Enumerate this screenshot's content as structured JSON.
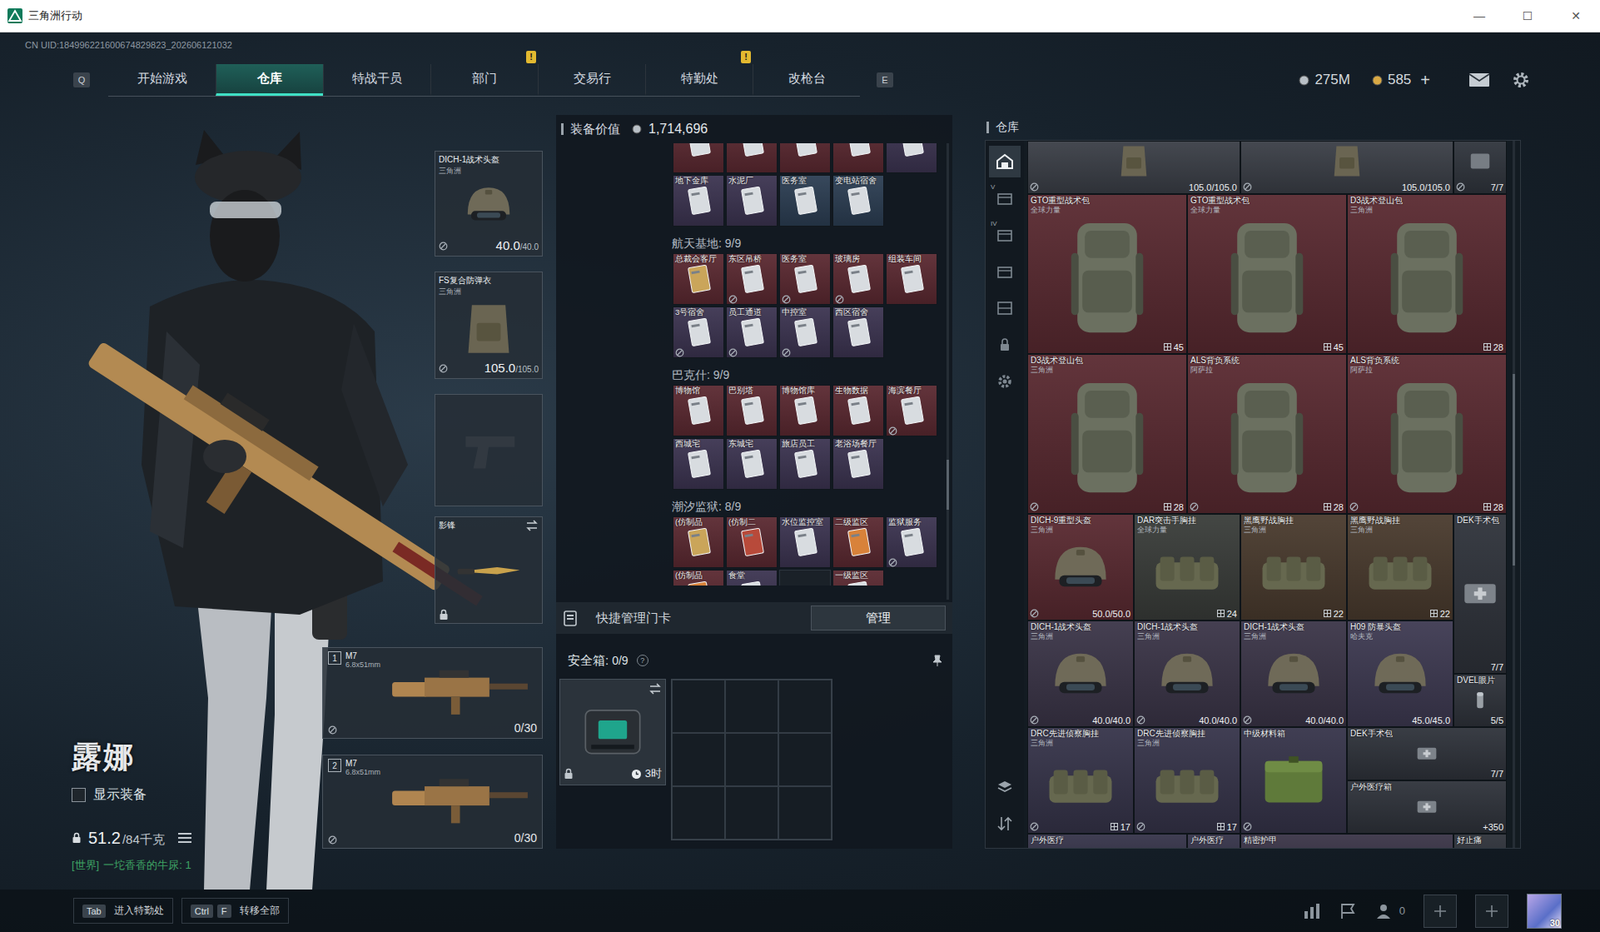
{
  "window": {
    "title": "三角洲行动",
    "controls": [
      "—",
      "☐",
      "✕"
    ]
  },
  "uid": "CN UID:184996221600674829823_202606121032",
  "nav": {
    "prev_key": "Q",
    "next_key": "E",
    "alert_mark": "!",
    "tabs": [
      {
        "label": "开始游戏",
        "selected": false,
        "alert": false
      },
      {
        "label": "仓库",
        "selected": true,
        "alert": false
      },
      {
        "label": "特战干员",
        "selected": false,
        "alert": false
      },
      {
        "label": "部门",
        "selected": false,
        "alert": true
      },
      {
        "label": "交易行",
        "selected": false,
        "alert": false
      },
      {
        "label": "特勤处",
        "selected": false,
        "alert": true
      },
      {
        "label": "改枪台",
        "selected": false,
        "alert": false
      }
    ]
  },
  "wallet": {
    "items": [
      {
        "kind": "silver",
        "value": "275M"
      },
      {
        "kind": "gold",
        "value": "585",
        "add": "+"
      }
    ]
  },
  "operator": {
    "name": "露娜",
    "show_equipment": {
      "label": "显示装备",
      "checked": false
    },
    "weight": "51.2",
    "weight_max": "/84千克"
  },
  "chat": {
    "channel": "[世界]",
    "text": "一坨香香的牛尿: 1"
  },
  "loadout": {
    "helmet": {
      "name": "DICH-1战术头盔",
      "brand": "三角洲",
      "durability": "40.0",
      "max": "/40.0",
      "bound": true
    },
    "armor": {
      "name": "FS复合防弹衣",
      "brand": "三角洲",
      "durability": "105.0",
      "max": "/105.0",
      "bound": true
    },
    "pistol": {
      "empty": true
    },
    "melee": {
      "name": "影锋",
      "locked": true
    },
    "weapons": [
      {
        "slot": "1",
        "name": "M7",
        "caliber": "6.8x51mm",
        "ammo": "0/30",
        "bound": true
      },
      {
        "slot": "2",
        "name": "M7",
        "caliber": "6.8x51mm",
        "ammo": "0/30",
        "bound": true
      }
    ]
  },
  "equipment_value": {
    "label": "装备价值",
    "value": "1,714,696"
  },
  "keycards": {
    "sections": [
      {
        "cards": [
          {
            "color": "#5a2830",
            "face": "silver",
            "bound": false
          },
          {
            "color": "#5a2830",
            "face": "silver",
            "bound": false
          },
          {
            "color": "#5a2830",
            "face": "silver",
            "bound": false
          },
          {
            "color": "#5a2830",
            "face": "silver",
            "bound": false
          },
          {
            "color": "#3b3350",
            "face": "silver",
            "bound": false
          },
          {
            "label": "地下金库",
            "color": "#3b3350",
            "face": "silver",
            "bound": false
          },
          {
            "label": "水泥厂",
            "color": "#3b3350",
            "face": "silver",
            "bound": false
          },
          {
            "label": "医务室",
            "color": "#2b3d52",
            "face": "silver",
            "bound": false
          },
          {
            "label": "变电站宿舍",
            "color": "#2b3d52",
            "face": "silver",
            "bound": false
          }
        ]
      },
      {
        "title": "航天基地: 9/9",
        "cards": [
          {
            "label": "总裁会客厅",
            "color": "#5a2830",
            "face": "gold",
            "bound": false
          },
          {
            "label": "东区吊桥",
            "color": "#5a2830",
            "face": "silver",
            "bound": true
          },
          {
            "label": "医务室",
            "color": "#5a2830",
            "face": "silver",
            "bound": true
          },
          {
            "label": "玻璃房",
            "color": "#5a2830",
            "face": "silver",
            "bound": true
          },
          {
            "label": "组装车间",
            "color": "#5a2830",
            "face": "silver",
            "bound": false
          },
          {
            "label": "3号宿舍",
            "color": "#3b3350",
            "face": "silver",
            "bound": true
          },
          {
            "label": "员工通道",
            "color": "#3b3350",
            "face": "silver",
            "bound": true
          },
          {
            "label": "中控室",
            "color": "#3b3350",
            "face": "silver",
            "bound": true
          },
          {
            "label": "西区宿舍",
            "color": "#3b3350",
            "face": "silver",
            "bound": false
          }
        ]
      },
      {
        "title": "巴克什: 9/9",
        "cards": [
          {
            "label": "博物馆",
            "color": "#5a2830",
            "face": "silver",
            "bound": false
          },
          {
            "label": "巴别塔",
            "color": "#5a2830",
            "face": "silver",
            "bound": false
          },
          {
            "label": "博物馆库",
            "color": "#5a2830",
            "face": "silver",
            "bound": false
          },
          {
            "label": "生物数据",
            "color": "#5a2830",
            "face": "silver",
            "bound": false
          },
          {
            "label": "海滨餐厅",
            "color": "#5a2830",
            "face": "silver",
            "bound": true
          },
          {
            "label": "西城宅",
            "color": "#3b3350",
            "face": "silver",
            "bound": false
          },
          {
            "label": "东城宅",
            "color": "#3b3350",
            "face": "silver",
            "bound": false
          },
          {
            "label": "旅店员工",
            "color": "#3b3350",
            "face": "silver",
            "bound": false
          },
          {
            "label": "老浴场餐厅",
            "color": "#3b3350",
            "face": "silver",
            "bound": false
          }
        ]
      },
      {
        "title": "潮汐监狱: 8/9",
        "cards": [
          {
            "label": "(仿制品",
            "color": "#5a2830",
            "face": "gold",
            "bound": false
          },
          {
            "label": "(仿制二",
            "color": "#5a2830",
            "face": "red",
            "bound": false
          },
          {
            "label": "水位监控室",
            "color": "#3b3350",
            "face": "silver",
            "bound": false
          },
          {
            "label": "二级监区",
            "color": "#5a2830",
            "face": "orange",
            "bound": false
          },
          {
            "label": "监狱服务",
            "color": "#3b3350",
            "face": "silver",
            "bound": true
          },
          {
            "label": "(仿制品",
            "color": "#5a2830",
            "face": "orange",
            "bound": false
          },
          {
            "label": "食堂",
            "color": "#3b3350",
            "face": "silver",
            "bound": false
          },
          {
            "empty": true
          },
          {
            "label": "一级监区",
            "color": "#5a2830",
            "face": "silver",
            "bound": false
          }
        ]
      }
    ]
  },
  "quick_manage": {
    "label": "快捷管理门卡",
    "button": "管理"
  },
  "safebox": {
    "label": "安全箱:",
    "count": "0/9",
    "help": "?",
    "timer": "3时",
    "locked": true
  },
  "warehouse": {
    "title": "仓库",
    "sidebar": [
      {
        "kind": "home",
        "selected": true
      },
      {
        "kind": "crate",
        "label": "V",
        "selected": false
      },
      {
        "kind": "crate",
        "label": "IV",
        "selected": false
      },
      {
        "kind": "crate",
        "selected": false
      },
      {
        "kind": "rack",
        "selected": false
      },
      {
        "kind": "lock",
        "selected": false
      },
      {
        "kind": "gear",
        "selected": false
      },
      {
        "kind": "layers",
        "selected": false
      },
      {
        "kind": "sort",
        "selected": false
      }
    ],
    "items": [
      {
        "kind": "vest",
        "color": "#3b3f47",
        "value": "105.0/105.0",
        "bound": true
      },
      {
        "kind": "vest",
        "color": "#3b3f47",
        "value": "105.0/105.0",
        "bound": true
      },
      {
        "kind": "misc",
        "color": "#30353d",
        "value": "7/7",
        "bound": true
      },
      {
        "name": "GTO重型战术包",
        "brand": "全球力量",
        "kind": "backpack",
        "color": "#5a2a31",
        "value": "45",
        "bound": false
      },
      {
        "name": "GTO重型战术包",
        "brand": "全球力量",
        "kind": "backpack",
        "color": "#5a2a31",
        "value": "45",
        "bound": false
      },
      {
        "name": "D3战术登山包",
        "brand": "三角洲",
        "kind": "backpack",
        "color": "#5a2a31",
        "value": "28",
        "bound": false
      },
      {
        "name": "D3战术登山包",
        "brand": "三角洲",
        "kind": "backpack",
        "color": "#5a2a31",
        "value": "28",
        "bound": true
      },
      {
        "name": "ALS背负系统",
        "brand": "阿萨拉",
        "kind": "backpack",
        "color": "#5a2a31",
        "value": "28",
        "bound": true
      },
      {
        "name": "ALS背负系统",
        "brand": "阿萨拉",
        "kind": "backpack",
        "color": "#5a2a31",
        "value": "28",
        "bound": true
      },
      {
        "name": "DICH-9重型头盔",
        "brand": "三角洲",
        "kind": "helmet",
        "color": "#5a2a31",
        "value": "50.0/50.0",
        "bound": true
      },
      {
        "name": "DAR突击手胸挂",
        "brand": "全球力量",
        "kind": "rig",
        "color": "#3a3d3a",
        "value": "24",
        "bound": false
      },
      {
        "name": "黑鹰野战胸挂",
        "brand": "三角洲",
        "kind": "rig",
        "color": "#4a3b2e",
        "value": "22",
        "bound": false
      },
      {
        "name": "黑鹰野战胸挂",
        "brand": "三角洲",
        "kind": "rig",
        "color": "#4a3b2e",
        "value": "22",
        "bound": false
      },
      {
        "name": "DEK手术包",
        "kind": "medkit",
        "color": "#2f333b",
        "value": "7/7",
        "bound": false
      },
      {
        "name": "DICH-1战术头盔",
        "brand": "三角洲",
        "kind": "helmet",
        "color": "#3b3548",
        "value": "40.0/40.0",
        "bound": true
      },
      {
        "name": "DICH-1战术头盔",
        "brand": "三角洲",
        "kind": "helmet",
        "color": "#3b3548",
        "value": "40.0/40.0",
        "bound": true
      },
      {
        "name": "DICH-1战术头盔",
        "brand": "三角洲",
        "kind": "helmet",
        "color": "#3b3548",
        "value": "40.0/40.0",
        "bound": true
      },
      {
        "name": "H09 防暴头盔",
        "brand": "哈夫克",
        "kind": "helmet",
        "color": "#3e3a52",
        "value": "45.0/45.0",
        "bound": false
      },
      {
        "name": "DVEL眼片",
        "kind": "lens",
        "color": "#2f333b",
        "value": "5/5",
        "bound": false
      },
      {
        "name": "DRC先进侦察胸挂",
        "brand": "三角洲",
        "kind": "rig",
        "color": "#36344a",
        "value": "17",
        "bound": true
      },
      {
        "name": "DRC先进侦察胸挂",
        "brand": "三角洲",
        "kind": "rig",
        "color": "#36344a",
        "value": "17",
        "bound": true
      },
      {
        "name": "中级材料箱",
        "kind": "case",
        "color": "#36344a",
        "bound": true
      },
      {
        "name": "DEK手术包",
        "kind": "medkit",
        "color": "#2f333b",
        "value": "7/7",
        "bound": false
      },
      {
        "name": "户外医疗箱",
        "kind": "medkit",
        "color": "#2f333b",
        "value": "+350",
        "bound": false
      },
      {
        "name": "户外医疗",
        "kind": "medkit",
        "color": "#36344a"
      },
      {
        "name": "户外医疗",
        "kind": "medkit",
        "color": "#36344a"
      },
      {
        "name": "精密护甲",
        "kind": "misc",
        "color": "#3b3548"
      },
      {
        "name": "好止痛",
        "kind": "medkit",
        "color": "#2f333b"
      }
    ]
  },
  "hints": [
    {
      "keys": [
        "Tab"
      ],
      "label": "进入特勤处"
    },
    {
      "keys": [
        "Ctrl",
        "F"
      ],
      "label": "转移全部"
    }
  ],
  "social": {
    "friends": "0",
    "level": "30"
  }
}
